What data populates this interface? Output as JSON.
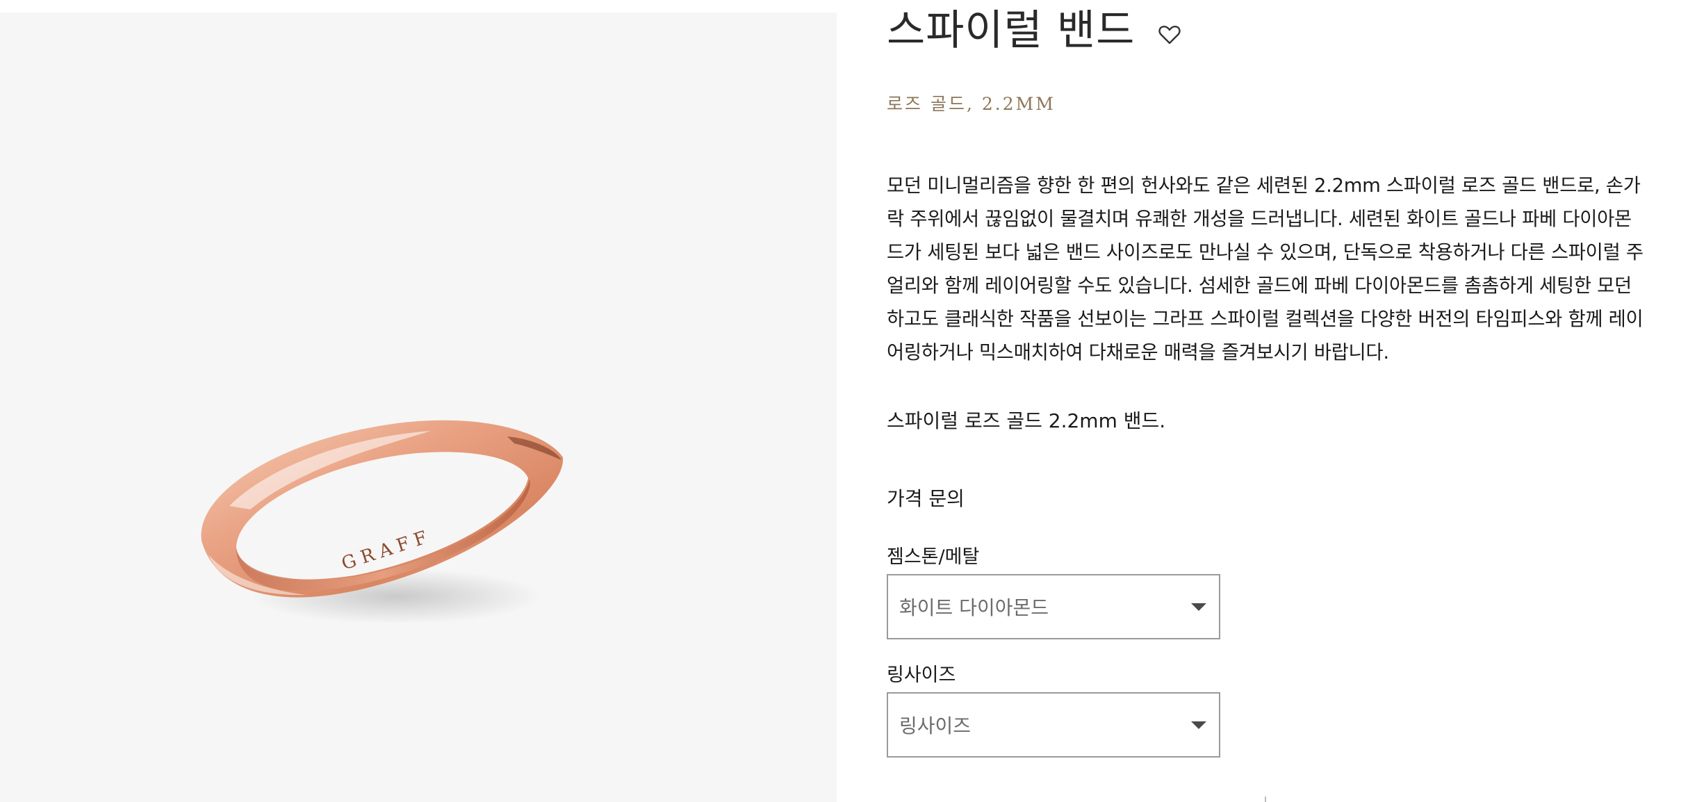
{
  "product": {
    "title": "스파이럴 밴드",
    "subtitle": "로즈 골드, 2.2MM",
    "description": "모던 미니멀리즘을 향한 한 편의 헌사와도 같은 세련된 2.2mm 스파이럴 로즈 골드 밴드로, 손가락 주위에서 끊임없이 물결치며 유쾌한 개성을 드러냅니다. 세련된 화이트 골드나 파베 다이아몬드가 세팅된 보다 넓은 밴드 사이즈로도 만나실 수 있으며, 단독으로 착용하거나 다른 스파이럴 주얼리와 함께 레이어링할 수도 있습니다. 섬세한 골드에 파베 다이아몬드를 촘촘하게 세팅한 모던하고도 클래식한 작품을 선보이는 그라프 스파이럴 컬렉션을 다양한 버전의 타임피스와 함께 레이어링하거나 믹스매치하여 다채로운 매력을 즐겨보시기 바랍니다.",
    "short_description": "스파이럴 로즈 골드 2.2mm 밴드.",
    "price_inquiry": "가격 문의",
    "ring_engraving": "GRAFF"
  },
  "options": {
    "gemstone": {
      "label": "젬스톤/메탈",
      "selected": "화이트 다이아몬드"
    },
    "ring_size": {
      "label": "링사이즈",
      "selected": "링사이즈"
    }
  },
  "icons": {
    "wishlist": "heart-outline-icon",
    "dropdown": "caret-down-icon"
  },
  "colors": {
    "subtitle_gold": "#8c7559",
    "image_background": "#f7f6f6",
    "rose_gold": "#e9a27f",
    "select_border": "#9a9a9a"
  }
}
